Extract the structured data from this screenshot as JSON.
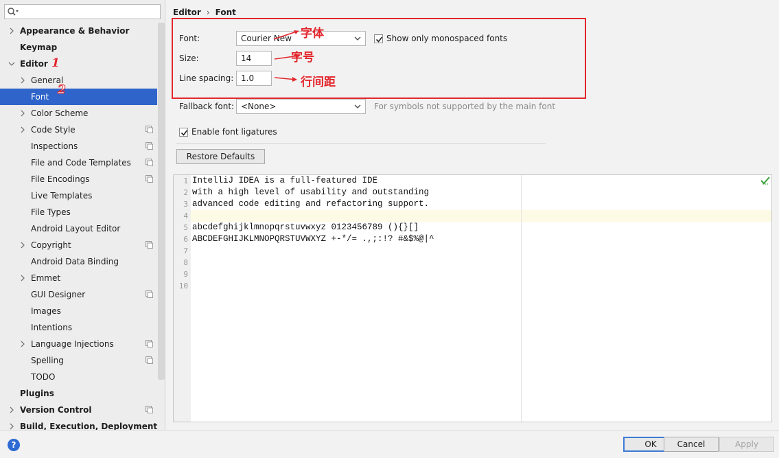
{
  "search": {
    "value": "",
    "placeholder": ""
  },
  "sidebar": {
    "items": [
      {
        "label": "Appearance & Behavior",
        "bold": true,
        "arrow": true,
        "level": 0,
        "project": false
      },
      {
        "label": "Keymap",
        "bold": true,
        "arrow": false,
        "level": 0,
        "project": false
      },
      {
        "label": "Editor",
        "bold": true,
        "arrow": "down",
        "level": 0,
        "project": false
      },
      {
        "label": "General",
        "bold": false,
        "arrow": true,
        "level": 1,
        "project": false
      },
      {
        "label": "Font",
        "bold": false,
        "arrow": false,
        "level": 1,
        "project": false,
        "selected": true
      },
      {
        "label": "Color Scheme",
        "bold": false,
        "arrow": true,
        "level": 1,
        "project": false
      },
      {
        "label": "Code Style",
        "bold": false,
        "arrow": true,
        "level": 1,
        "project": true
      },
      {
        "label": "Inspections",
        "bold": false,
        "arrow": false,
        "level": 1,
        "project": true
      },
      {
        "label": "File and Code Templates",
        "bold": false,
        "arrow": false,
        "level": 1,
        "project": true
      },
      {
        "label": "File Encodings",
        "bold": false,
        "arrow": false,
        "level": 1,
        "project": true
      },
      {
        "label": "Live Templates",
        "bold": false,
        "arrow": false,
        "level": 1,
        "project": false
      },
      {
        "label": "File Types",
        "bold": false,
        "arrow": false,
        "level": 1,
        "project": false
      },
      {
        "label": "Android Layout Editor",
        "bold": false,
        "arrow": false,
        "level": 1,
        "project": false
      },
      {
        "label": "Copyright",
        "bold": false,
        "arrow": true,
        "level": 1,
        "project": true
      },
      {
        "label": "Android Data Binding",
        "bold": false,
        "arrow": false,
        "level": 1,
        "project": false
      },
      {
        "label": "Emmet",
        "bold": false,
        "arrow": true,
        "level": 1,
        "project": false
      },
      {
        "label": "GUI Designer",
        "bold": false,
        "arrow": false,
        "level": 1,
        "project": true
      },
      {
        "label": "Images",
        "bold": false,
        "arrow": false,
        "level": 1,
        "project": false
      },
      {
        "label": "Intentions",
        "bold": false,
        "arrow": false,
        "level": 1,
        "project": false
      },
      {
        "label": "Language Injections",
        "bold": false,
        "arrow": true,
        "level": 1,
        "project": true
      },
      {
        "label": "Spelling",
        "bold": false,
        "arrow": false,
        "level": 1,
        "project": true
      },
      {
        "label": "TODO",
        "bold": false,
        "arrow": false,
        "level": 1,
        "project": false
      },
      {
        "label": "Plugins",
        "bold": true,
        "arrow": false,
        "level": 0,
        "project": false
      },
      {
        "label": "Version Control",
        "bold": true,
        "arrow": true,
        "level": 0,
        "project": true
      },
      {
        "label": "Build, Execution, Deployment",
        "bold": true,
        "arrow": true,
        "level": 0,
        "project": false
      }
    ]
  },
  "breadcrumb": {
    "parent": "Editor",
    "separator": "›",
    "current": "Font"
  },
  "form": {
    "font_label": "Font:",
    "font_value": "Courier New",
    "monospaced_label": "Show only monospaced fonts",
    "monospaced_checked": true,
    "size_label": "Size:",
    "size_value": "14",
    "line_spacing_label": "Line spacing:",
    "line_spacing_value": "1.0",
    "fallback_label": "Fallback font:",
    "fallback_value": "<None>",
    "fallback_hint": "For symbols not supported by the main font",
    "ligatures_label": "Enable font ligatures",
    "ligatures_checked": true,
    "restore_label": "Restore Defaults"
  },
  "annotations": {
    "font_note": "字体",
    "size_note": "字号",
    "spacing_note": "行间距",
    "marker_1": "1",
    "marker_2": "2",
    "accent_color": "#e3262c"
  },
  "preview": {
    "line_numbers": [
      "1",
      "2",
      "3",
      "4",
      "5",
      "6",
      "7",
      "8",
      "9",
      "10"
    ],
    "lines": [
      "IntelliJ IDEA is a full-featured IDE",
      "with a high level of usability and outstanding",
      "advanced code editing and refactoring support.",
      "",
      "abcdefghijklmnopqrstuvwxyz 0123456789 (){}[]",
      "ABCDEFGHIJKLMNOPQRSTUVWXYZ +-*/= .,;:!? #&$%@|^",
      "",
      "",
      "",
      ""
    ]
  },
  "buttons": {
    "ok": "OK",
    "cancel": "Cancel",
    "apply": "Apply",
    "help": "?"
  },
  "colors": {
    "selection": "#2f65ca",
    "accent": "#3d7ad4",
    "annotation": "#e3262c"
  }
}
